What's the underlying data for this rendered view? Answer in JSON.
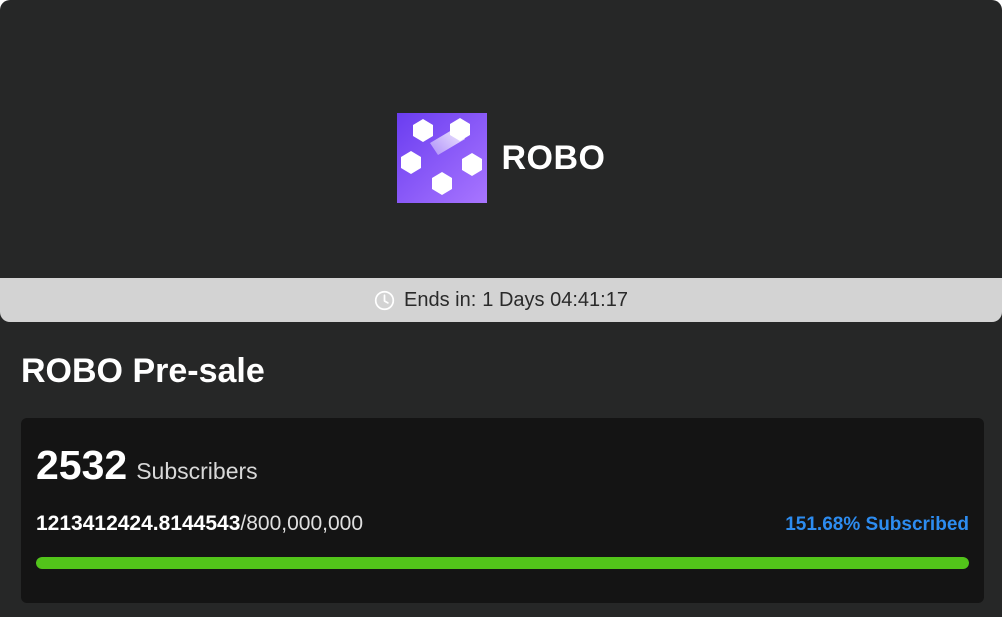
{
  "token": {
    "name": "ROBO",
    "logo_icon": "robo-hexagon-logo",
    "logo_colors": [
      "#7c4dff",
      "#9f6bff"
    ]
  },
  "countdown": {
    "icon": "clock-icon",
    "prefix": "Ends in:",
    "value": "1 Days 04:41:17"
  },
  "presale": {
    "title": "ROBO Pre-sale",
    "subscribers_count": "2532",
    "subscribers_label": "Subscribers",
    "raised": "1213412424.8144543",
    "separator": "/",
    "cap": "800,000,000",
    "subscribed_text": "151.68% Subscribed",
    "progress_fraction": 1.0,
    "progress_color": "#52c41a",
    "accent_color": "#2d8cf0"
  }
}
